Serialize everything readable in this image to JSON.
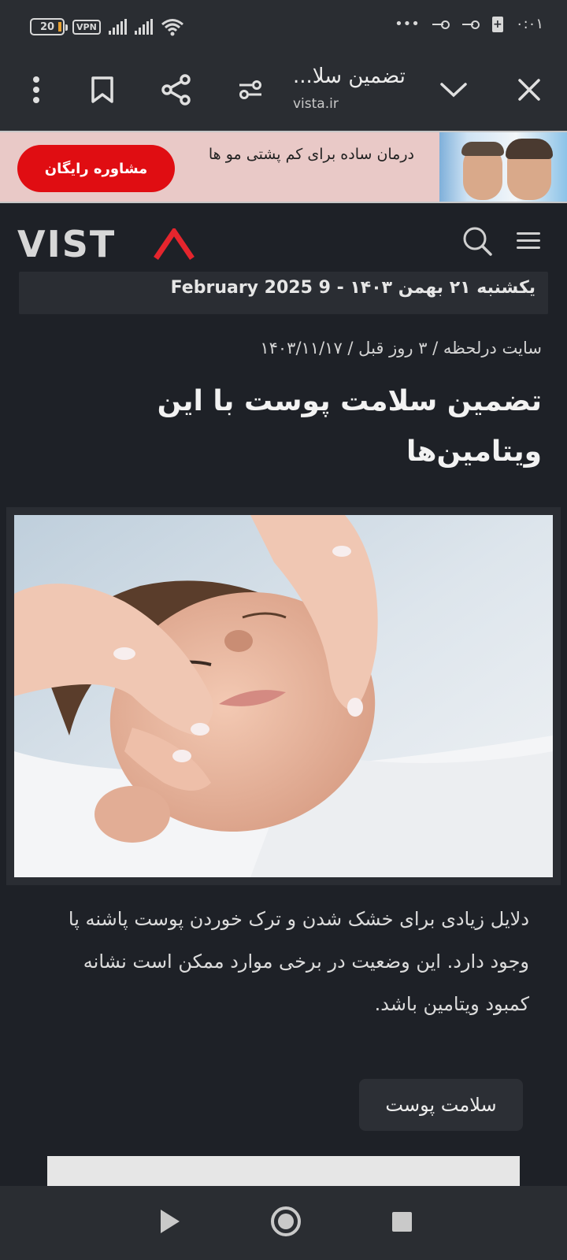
{
  "status_bar": {
    "battery": "20",
    "vpn": "VPN",
    "time": "۰:۰۱",
    "dots": "•••"
  },
  "browser": {
    "title": "تضمین سلا...",
    "url": "vista.ir"
  },
  "ad": {
    "text": "درمان ساده برای کم پشتی مو ها",
    "button": "مشاوره رایگان"
  },
  "site": {
    "logo": "VIST",
    "date": "یکشنبه ۲۱ بهمن ۱۴۰۳ - 9 February 2025"
  },
  "article": {
    "meta": "سایت درلحظه / ۳ روز قبل / ۱۴۰۳/۱۱/۱۷",
    "headline": "تضمین سلامت پوست با این ویتامین‌ها",
    "lead": "دلایل زیادی برای خشک شدن و ترک خوردن پوست پاشنه پا وجود دارد. این وضعیت در برخی موارد ممکن است نشانه کمبود ویتامین باشد.",
    "tag": "سلامت پوست"
  },
  "colors": {
    "accent_red": "#e00d12",
    "page_bg": "#1e2127",
    "bar_bg": "#2a2d32"
  }
}
